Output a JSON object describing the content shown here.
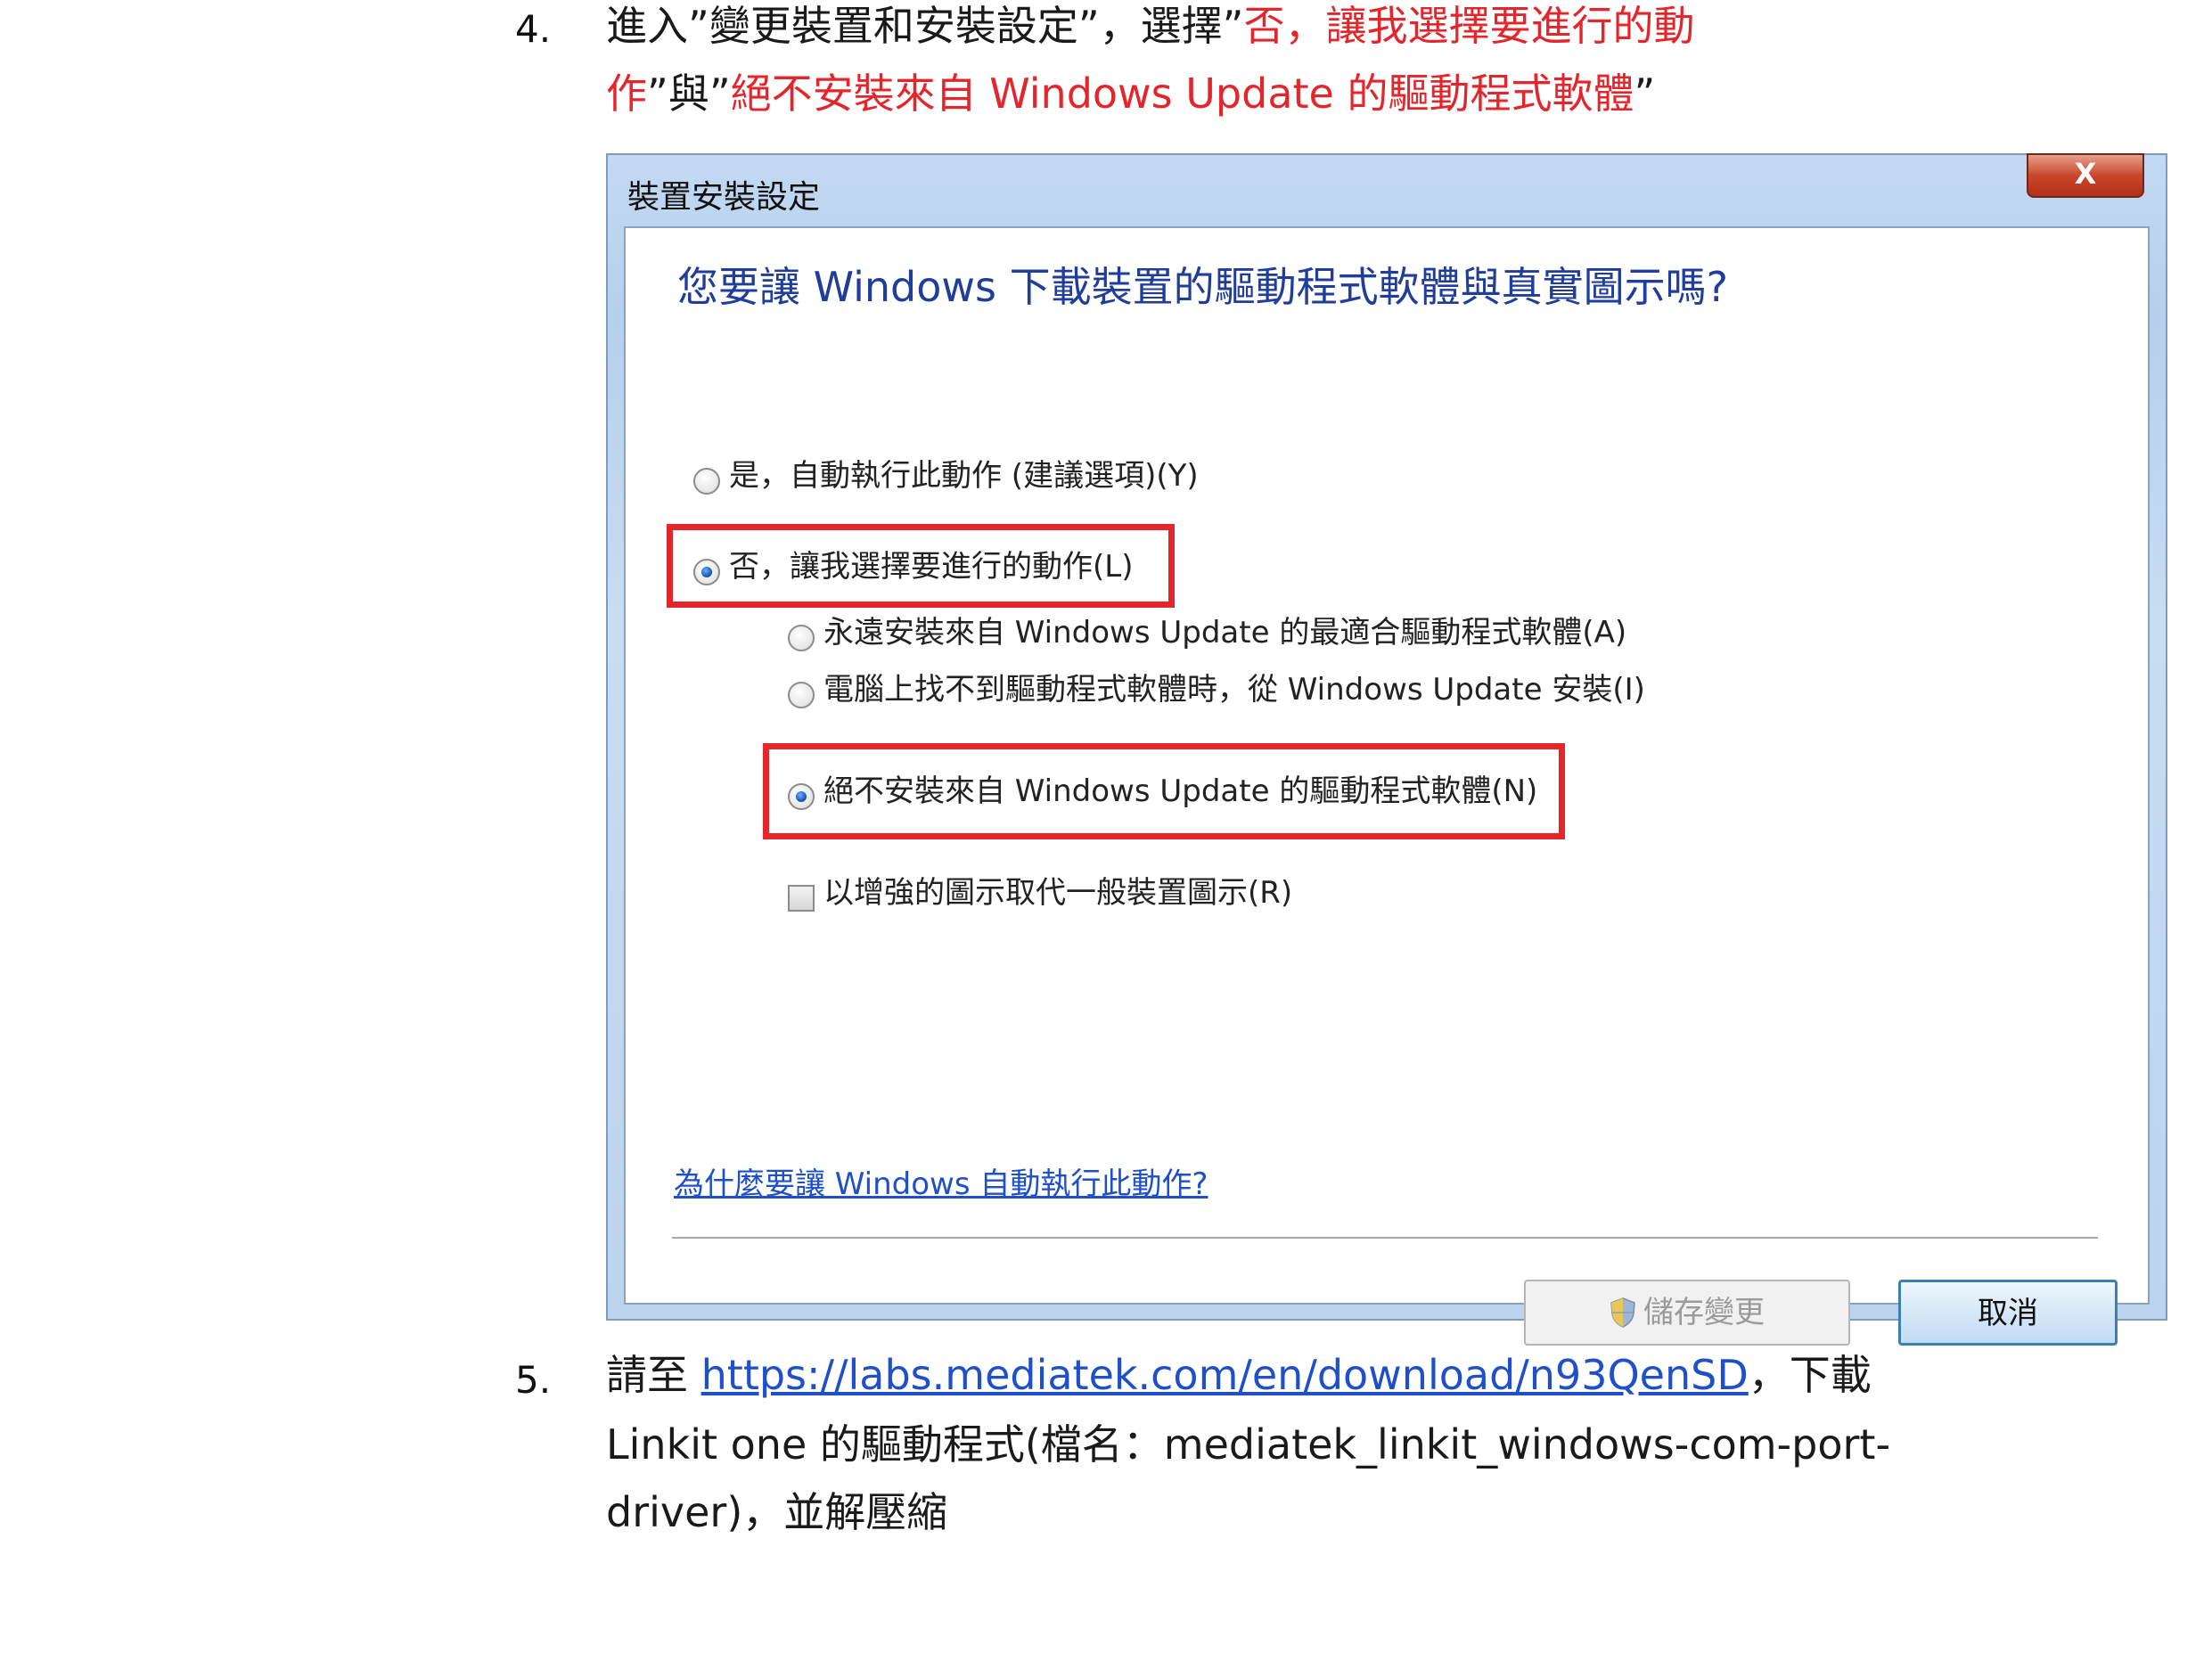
{
  "step4": {
    "number": "4.",
    "line1_plain": "進入”變更裝置和安裝設定”，選擇”",
    "line1_red": "否，讓我選擇要進行的動",
    "line2_red_a": "作",
    "line2_mid": "”與”",
    "line2_red_b": "絕不安裝來自 Windows Update 的驅動程式軟體",
    "line2_end": "”"
  },
  "dialog": {
    "title": "裝置安裝設定",
    "close_label": "X",
    "question": "您要讓 Windows 下載裝置的驅動程式軟體與真實圖示嗎?",
    "option_yes": "是，自動執行此動作 (建議選項)(Y)",
    "option_no": "否，讓我選擇要進行的動作(L)",
    "sub_always": "永遠安裝來自 Windows Update 的最適合驅動程式軟體(A)",
    "sub_when_missing": "電腦上找不到驅動程式軟體時，從 Windows Update 安裝(I)",
    "sub_never": "絕不安裝來自 Windows Update 的驅動程式軟體(N)",
    "checkbox_icons": "以增強的圖示取代一般裝置圖示(R)",
    "help_link": "為什麼要讓 Windows 自動執行此動作?",
    "save_button": "儲存變更",
    "cancel_button": "取消"
  },
  "step5": {
    "number": "5.",
    "line1_prefix": "請至 ",
    "url": "https://labs.mediatek.com/en/download/n93QenSD",
    "line1_suffix": "，下載",
    "line2": "Linkit one 的驅動程式(檔名：mediatek_linkit_windows-com-port-",
    "line3": "driver)，並解壓縮"
  },
  "colors": {
    "highlight_red": "#e3262c",
    "link_blue": "#1f4fc9",
    "question_blue": "#1f3d99"
  }
}
